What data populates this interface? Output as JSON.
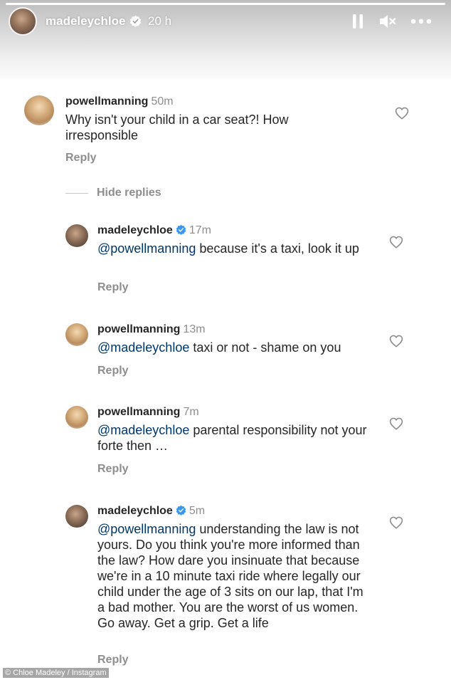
{
  "header": {
    "username": "madeleychloe",
    "time": "20 h",
    "progress": 1.0,
    "icons": {
      "verified": "verified-badge-icon",
      "pause": "pause-icon",
      "mute": "speaker-muted-icon",
      "more": "more-options-icon"
    }
  },
  "thread": {
    "parent": {
      "username": "powellmanning",
      "time": "50m",
      "text": "Why isn't your child in a car seat?! How irresponsible",
      "reply_label": "Reply"
    },
    "hide_replies_label": "Hide replies",
    "replies": [
      {
        "username": "madeleychloe",
        "verified": true,
        "time": "17m",
        "mention": "@powellmanning",
        "text": " because it's a taxi, look it up",
        "reply_label": "Reply"
      },
      {
        "username": "powellmanning",
        "verified": false,
        "time": "13m",
        "mention": "@madeleychloe",
        "text": " taxi or not - shame on you",
        "reply_label": "Reply"
      },
      {
        "username": "powellmanning",
        "verified": false,
        "time": "7m",
        "mention": "@madeleychloe",
        "text": " parental responsibility not your forte then …",
        "reply_label": "Reply"
      },
      {
        "username": "madeleychloe",
        "verified": true,
        "time": "5m",
        "mention": "@powellmanning",
        "text": " understanding the law is not yours. Do you think you're more informed than the law? How dare you insinuate that because we're in a 10 minute taxi ride where legally our child under the age of 3 sits on our lap, that I'm a bad mother. You are the worst of us women. Go away. Get a grip. Get a life",
        "reply_label": "Reply"
      }
    ]
  },
  "colors": {
    "mention": "#00376b",
    "verified": "#3897f0",
    "muted_text": "#8e8e8e"
  },
  "credit": "© Chloe Madeley / Instagram"
}
